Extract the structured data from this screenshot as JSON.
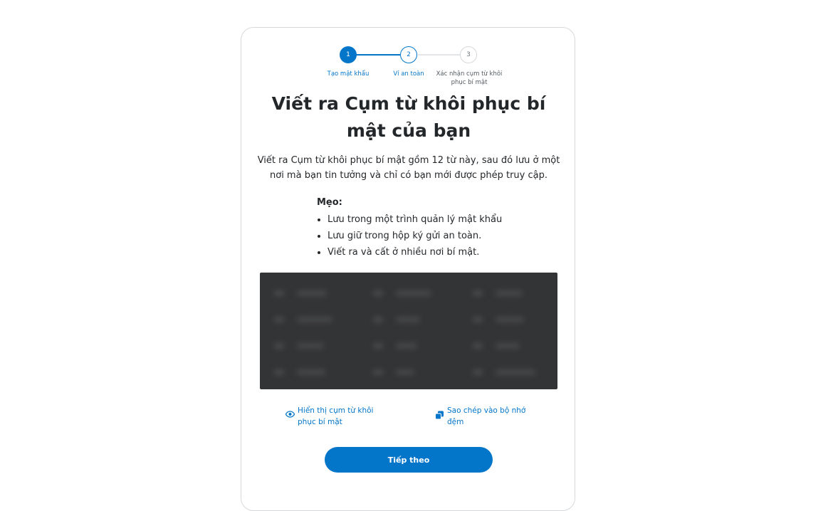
{
  "stepper": {
    "steps": [
      {
        "number": "1",
        "label": "Tạo mật khẩu"
      },
      {
        "number": "2",
        "label": "Ví an toàn"
      },
      {
        "number": "3",
        "label": "Xác nhận cụm từ khôi phục bí mật"
      }
    ],
    "active_step": 1
  },
  "title": "Viết ra Cụm từ khôi phục bí mật của bạn",
  "description": "Viết ra Cụm từ khôi phục bí mật gồm 12 từ này, sau đó lưu ở một nơi mà bạn tin tưởng và chỉ có bạn mới được phép truy cập.",
  "tips": {
    "heading": "Mẹo:",
    "items": [
      "Lưu trong một trình quản lý mật khẩu",
      "Lưu giữ trong hộp ký gửi an toàn.",
      "Viết ra và cất ở nhiều nơi bí mật."
    ]
  },
  "actions": {
    "reveal_label": "Hiển thị cụm từ khôi phục bí mật",
    "copy_label": "Sao chép vào bộ nhớ đệm"
  },
  "next_button": "Tiếp theo",
  "colors": {
    "primary": "#0376c9",
    "phrase_box": "#333436",
    "text": "#24272a"
  }
}
